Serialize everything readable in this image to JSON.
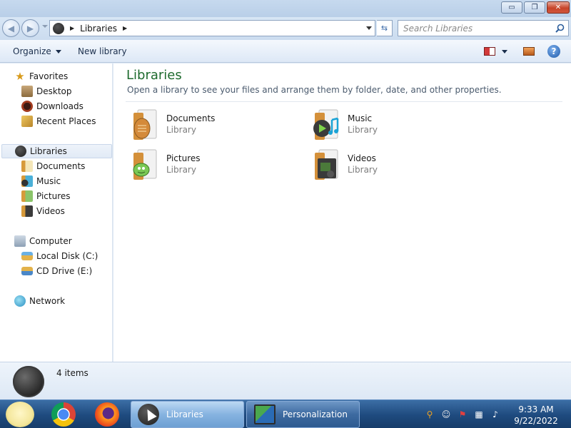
{
  "window": {
    "minimize_glyph": "▭",
    "maximize_glyph": "❐",
    "close_glyph": "✕"
  },
  "address_bar": {
    "breadcrumb": [
      "Libraries"
    ],
    "search_placeholder": "Search Libraries"
  },
  "command_bar": {
    "organize": "Organize",
    "new_library": "New library",
    "help_glyph": "?"
  },
  "sidebar": {
    "favorites": {
      "label": "Favorites",
      "items": [
        "Desktop",
        "Downloads",
        "Recent Places"
      ]
    },
    "libraries": {
      "label": "Libraries",
      "items": [
        "Documents",
        "Music",
        "Pictures",
        "Videos"
      ]
    },
    "computer": {
      "label": "Computer",
      "items": [
        "Local Disk (C:)",
        "CD Drive (E:)"
      ]
    },
    "network": {
      "label": "Network"
    }
  },
  "main": {
    "title": "Libraries",
    "subtitle": "Open a library to see your files and arrange them by folder, date, and other properties.",
    "libraries": [
      {
        "name": "Documents",
        "type": "Library",
        "icon": "documents-library-icon"
      },
      {
        "name": "Music",
        "type": "Library",
        "icon": "music-library-icon"
      },
      {
        "name": "Pictures",
        "type": "Library",
        "icon": "pictures-library-icon"
      },
      {
        "name": "Videos",
        "type": "Library",
        "icon": "videos-library-icon"
      }
    ]
  },
  "details": {
    "item_count": "4 items"
  },
  "taskbar": {
    "tasks": [
      {
        "label": "Libraries",
        "active": true
      },
      {
        "label": "Personalization",
        "active": false
      }
    ],
    "clock": {
      "time": "9:33 AM",
      "date": "9/22/2022"
    }
  }
}
